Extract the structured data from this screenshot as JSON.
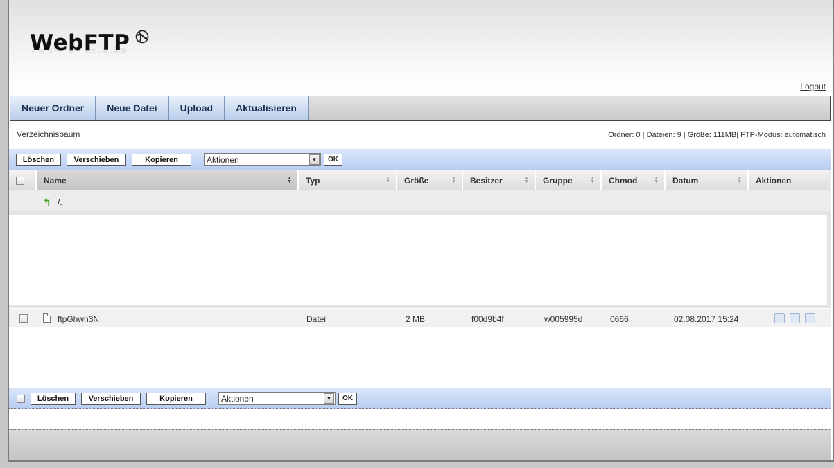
{
  "app": {
    "logo_text": "WebFTP"
  },
  "header": {
    "logout_label": "Logout"
  },
  "toolbar": {
    "buttons": [
      "Neuer Ordner",
      "Neue Datei",
      "Upload",
      "Aktualisieren"
    ]
  },
  "info": {
    "tree_label": "Verzeichnisbaum",
    "stats": "Ordner: 0 | Dateien: 9 | Größe: 111MB| FTP-Modus: automatisch"
  },
  "actions": {
    "delete_label": "Löschen",
    "move_label": "Verschieben",
    "copy_label": "Kopieren",
    "select_value": "Aktionen",
    "ok_label": "OK"
  },
  "table": {
    "columns": [
      "Name",
      "Typ",
      "Größe",
      "Besitzer",
      "Gruppe",
      "Chmod",
      "Datum",
      "Aktionen"
    ],
    "parent_label": "/.",
    "rows": [
      {
        "name": "ftpGhwn3N",
        "type": "Datei",
        "size": "2 MB",
        "owner": "f00d9b4f",
        "group": "w005995d",
        "chmod": "0666",
        "date": "02.08.2017 15:24"
      }
    ]
  }
}
